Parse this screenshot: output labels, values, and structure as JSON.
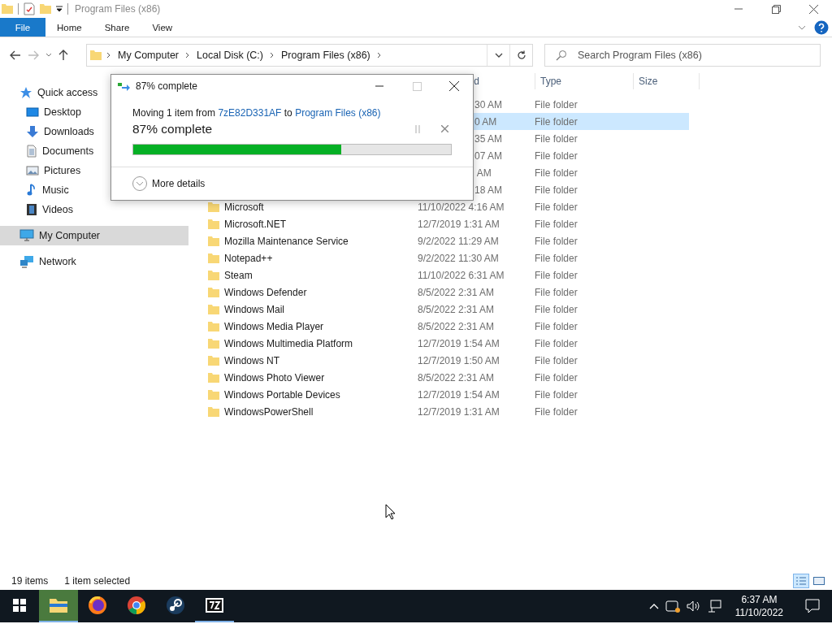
{
  "window": {
    "title": "Program Files (x86)"
  },
  "ribbon_tabs": [
    {
      "label": "File",
      "kind": "file"
    },
    {
      "label": "Home",
      "kind": "tab"
    },
    {
      "label": "Share",
      "kind": "tab"
    },
    {
      "label": "View",
      "kind": "tab"
    }
  ],
  "address": {
    "crumbs": [
      "My Computer",
      "Local Disk (C:)",
      "Program Files (x86)"
    ]
  },
  "search": {
    "placeholder": "Search Program Files (x86)"
  },
  "nav": [
    {
      "label": "Quick access",
      "kind": "star",
      "selected": false,
      "children": [
        {
          "label": "Desktop",
          "kind": "desktop",
          "selected": false
        },
        {
          "label": "Downloads",
          "kind": "download",
          "selected": false
        },
        {
          "label": "Documents",
          "kind": "document",
          "selected": false
        },
        {
          "label": "Pictures",
          "kind": "pictures",
          "selected": false
        },
        {
          "label": "Music",
          "kind": "music",
          "selected": false
        },
        {
          "label": "Videos",
          "kind": "videos",
          "selected": false
        }
      ]
    },
    {
      "label": "My Computer",
      "kind": "computer",
      "selected": true
    },
    {
      "label": "Network",
      "kind": "network",
      "selected": false
    }
  ],
  "list": {
    "columns": [
      {
        "label": "d",
        "kind": "covered"
      },
      {
        "label": "Type",
        "kind": "full"
      },
      {
        "label": "Size",
        "kind": "full"
      }
    ],
    "rows": [
      {
        "kind": "covered",
        "modified": "30 AM",
        "type": "File folder",
        "selected": false
      },
      {
        "kind": "covered",
        "modified": "0 AM",
        "type": "File folder",
        "selected": true
      },
      {
        "kind": "covered",
        "modified": "35 AM",
        "type": "File folder",
        "selected": false
      },
      {
        "kind": "covered",
        "modified": "07 AM",
        "type": "File folder",
        "selected": false
      },
      {
        "kind": "covered",
        "modified": " AM",
        "type": "File folder",
        "selected": false
      },
      {
        "kind": "covered",
        "modified": "18 AM",
        "type": "File folder",
        "selected": false
      },
      {
        "kind": "full",
        "name": "Microsoft",
        "modified": "11/10/2022 4:16 AM",
        "type": "File folder",
        "selected": false
      },
      {
        "kind": "full",
        "name": "Microsoft.NET",
        "modified": "12/7/2019 1:31 AM",
        "type": "File folder",
        "selected": false
      },
      {
        "kind": "full",
        "name": "Mozilla Maintenance Service",
        "modified": "9/2/2022 11:29 AM",
        "type": "File folder",
        "selected": false
      },
      {
        "kind": "full",
        "name": "Notepad++",
        "modified": "9/2/2022 11:30 AM",
        "type": "File folder",
        "selected": false
      },
      {
        "kind": "full",
        "name": "Steam",
        "modified": "11/10/2022 6:31 AM",
        "type": "File folder",
        "selected": false
      },
      {
        "kind": "full",
        "name": "Windows Defender",
        "modified": "8/5/2022 2:31 AM",
        "type": "File folder",
        "selected": false
      },
      {
        "kind": "full",
        "name": "Windows Mail",
        "modified": "8/5/2022 2:31 AM",
        "type": "File folder",
        "selected": false
      },
      {
        "kind": "full",
        "name": "Windows Media Player",
        "modified": "8/5/2022 2:31 AM",
        "type": "File folder",
        "selected": false
      },
      {
        "kind": "full",
        "name": "Windows Multimedia Platform",
        "modified": "12/7/2019 1:54 AM",
        "type": "File folder",
        "selected": false
      },
      {
        "kind": "full",
        "name": "Windows NT",
        "modified": "12/7/2019 1:50 AM",
        "type": "File folder",
        "selected": false
      },
      {
        "kind": "full",
        "name": "Windows Photo Viewer",
        "modified": "8/5/2022 2:31 AM",
        "type": "File folder",
        "selected": false
      },
      {
        "kind": "full",
        "name": "Windows Portable Devices",
        "modified": "12/7/2019 1:54 AM",
        "type": "File folder",
        "selected": false
      },
      {
        "kind": "full",
        "name": "WindowsPowerShell",
        "modified": "12/7/2019 1:31 AM",
        "type": "File folder",
        "selected": false
      }
    ]
  },
  "dialog": {
    "title": "87% complete",
    "prefix": "Moving 1 item from",
    "source": "7zE82D331AF",
    "middle": "to",
    "destination": "Program Files (x86)",
    "progress_label": "87% complete",
    "level": 0.655,
    "details": "More details"
  },
  "status_bar": {
    "count": "19 items",
    "selection": "1 item selected",
    "views": [
      {
        "kind": "details",
        "selected": true
      },
      {
        "kind": "tiles",
        "selected": false
      }
    ]
  },
  "taskbar": {
    "apps": [
      {
        "kind": "explorer",
        "selected": true,
        "running": true
      },
      {
        "kind": "firefox",
        "selected": false,
        "running": false
      },
      {
        "kind": "chrome",
        "selected": false,
        "running": false
      },
      {
        "kind": "steam",
        "selected": false,
        "running": false
      },
      {
        "kind": "sevenzip",
        "selected": false,
        "running": true
      }
    ],
    "time": "6:37 AM",
    "date": "11/10/2022"
  }
}
